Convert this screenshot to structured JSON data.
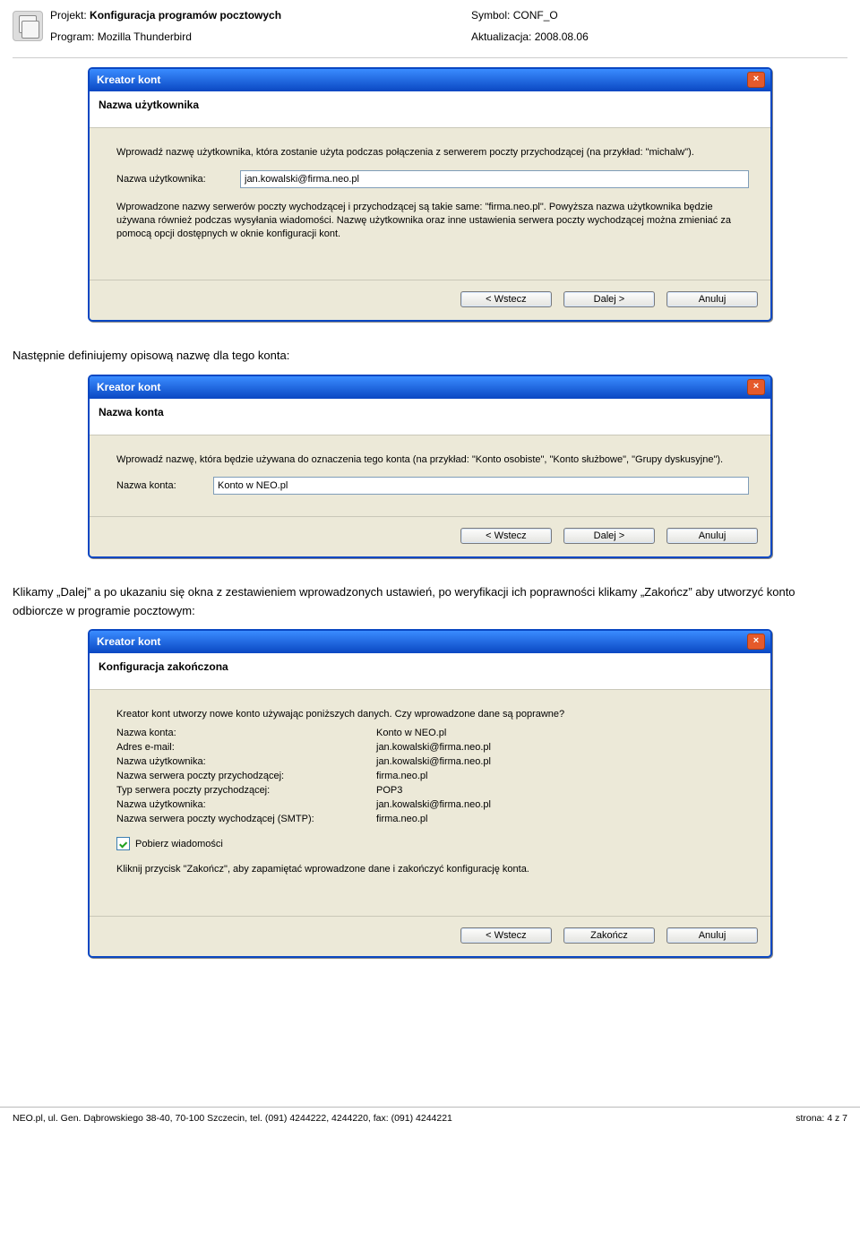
{
  "header": {
    "project_label": "Projekt:",
    "project_value": "Konfiguracja programów pocztowych",
    "program_label": "Program:",
    "program_value": "Mozilla Thunderbird",
    "symbol_label": "Symbol:",
    "symbol_value": "CONF_O",
    "update_label": "Aktualizacja:",
    "update_value": "2008.08.06"
  },
  "dialog1": {
    "title": "Kreator kont",
    "close": "×",
    "subhead": "Nazwa użytkownika",
    "intro": "Wprowadź nazwę użytkownika, która zostanie użyta podczas połączenia z serwerem poczty przychodzącej (na przykład: \"michalw\").",
    "field_label": "Nazwa użytkownika:",
    "field_value": "jan.kowalski@firma.neo.pl",
    "note": "Wprowadzone nazwy serwerów poczty wychodzącej i przychodzącej są takie same: \"firma.neo.pl\". Powyższa nazwa użytkownika będzie używana również podczas wysyłania wiadomości. Nazwę użytkownika oraz inne ustawienia serwera poczty wychodzącej można zmieniać za pomocą opcji dostępnych w oknie konfiguracji kont.",
    "back": "< Wstecz",
    "next": "Dalej >",
    "cancel": "Anuluj"
  },
  "text1": "Następnie definiujemy opisową nazwę dla tego konta:",
  "dialog2": {
    "title": "Kreator kont",
    "close": "×",
    "subhead": "Nazwa konta",
    "intro": "Wprowadź nazwę, która będzie używana do oznaczenia tego konta (na przykład: \"Konto osobiste\", \"Konto służbowe\", \"Grupy dyskusyjne\").",
    "field_label": "Nazwa konta:",
    "field_value": "Konto w NEO.pl",
    "back": "< Wstecz",
    "next": "Dalej >",
    "cancel": "Anuluj"
  },
  "text2": "Klikamy „Dalej” a po ukazaniu się okna z zestawieniem wprowadzonych ustawień, po weryfikacji ich poprawności klikamy „Zakończ” aby utworzyć konto odbiorcze w programie pocztowym:",
  "dialog3": {
    "title": "Kreator kont",
    "close": "×",
    "subhead": "Konfiguracja zakończona",
    "intro": "Kreator kont utworzy nowe konto używając poniższych danych. Czy wprowadzone dane są poprawne?",
    "rows": [
      {
        "label": "Nazwa konta:",
        "value": "Konto w NEO.pl"
      },
      {
        "label": "Adres e-mail:",
        "value": "jan.kowalski@firma.neo.pl"
      },
      {
        "label": "Nazwa użytkownika:",
        "value": "jan.kowalski@firma.neo.pl"
      },
      {
        "label": "Nazwa serwera poczty przychodzącej:",
        "value": "firma.neo.pl"
      },
      {
        "label": "Typ serwera poczty przychodzącej:",
        "value": "POP3"
      },
      {
        "label": "Nazwa użytkownika:",
        "value": "jan.kowalski@firma.neo.pl"
      },
      {
        "label": "Nazwa serwera poczty wychodzącej (SMTP):",
        "value": "firma.neo.pl"
      }
    ],
    "checkbox_label": "Pobierz wiadomości",
    "end_note": "Kliknij przycisk \"Zakończ\", aby zapamiętać wprowadzone dane i zakończyć konfigurację konta.",
    "back": "< Wstecz",
    "finish": "Zakończ",
    "cancel": "Anuluj"
  },
  "footer": {
    "left": "NEO.pl, ul. Gen. Dąbrowskiego 38-40, 70-100 Szczecin, tel. (091) 4244222, 4244220, fax: (091) 4244221",
    "right": "strona: 4 z 7"
  }
}
